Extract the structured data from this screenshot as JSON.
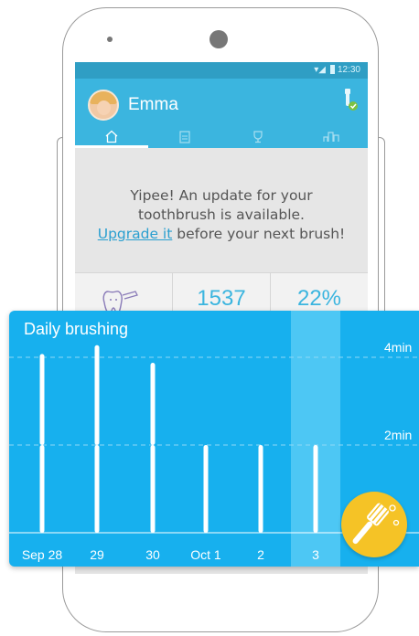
{
  "status_bar": {
    "time": "12:30"
  },
  "header": {
    "user_name": "Emma",
    "tabs": [
      "home",
      "journal",
      "trophies",
      "stats"
    ]
  },
  "notice": {
    "line1": "Yipee! An update for your",
    "line2": "toothbrush is available.",
    "link": "Upgrade it",
    "line3_rest": " before your next brush!"
  },
  "stats": {
    "value1": "1537",
    "value2": "22%"
  },
  "chart_data": {
    "type": "bar",
    "title": "Daily brushing",
    "categories": [
      "Sep 28",
      "29",
      "30",
      "Oct 1",
      "2",
      "3"
    ],
    "series": [
      {
        "values": [
          2,
          2,
          2,
          2,
          2,
          2
        ]
      },
      {
        "values": [
          2.2,
          2.4,
          2.0,
          0,
          0,
          0
        ]
      }
    ],
    "y_ticks": [
      "2min",
      "4min"
    ],
    "ylim": [
      0,
      4.8
    ],
    "highlighted_category": "3",
    "colors": {
      "background": "#17b0ee",
      "bar": "#ffffff",
      "highlight": "#4dc7f4"
    }
  }
}
